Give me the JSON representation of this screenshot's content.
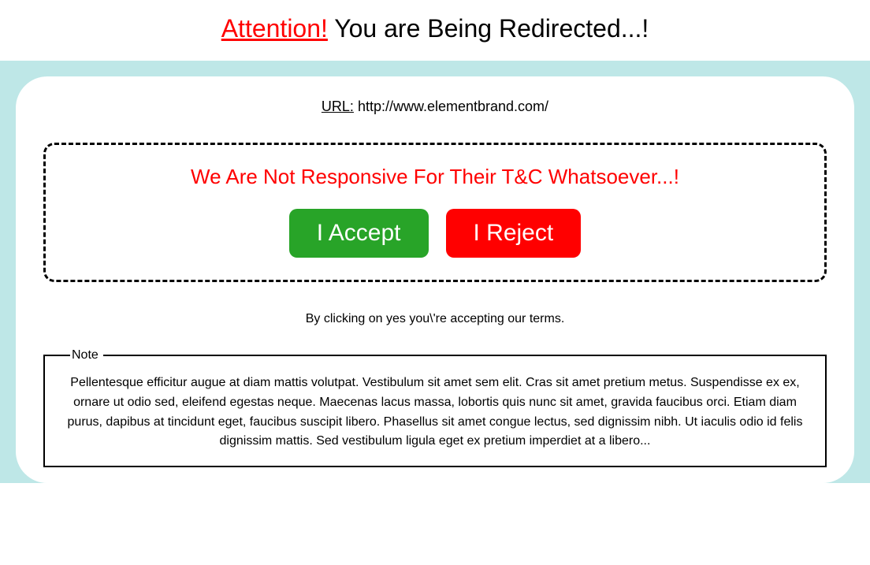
{
  "header": {
    "attention": "Attention!",
    "rest": " You are Being Redirected...!"
  },
  "url": {
    "label": "URL:",
    "value": " http://www.elementbrand.com/"
  },
  "disclaimer": {
    "text": "We Are Not Responsive For Their T&C Whatsoever...!"
  },
  "buttons": {
    "accept": "I Accept",
    "reject": "I Reject"
  },
  "terms_note": "By clicking on yes you\\'re accepting our terms.",
  "note": {
    "legend": "Note",
    "body": "Pellentesque efficitur augue at diam mattis volutpat. Vestibulum sit amet sem elit. Cras sit amet pretium metus. Suspendisse ex ex, ornare ut odio sed, eleifend egestas neque. Maecenas lacus massa, lobortis quis nunc sit amet, gravida faucibus orci. Etiam diam purus, dapibus at tincidunt eget, faucibus suscipit libero. Phasellus sit amet congue lectus, sed dignissim nibh. Ut iaculis odio id felis dignissim mattis. Sed vestibulum ligula eget ex pretium imperdiet at a libero..."
  },
  "colors": {
    "accent_red": "#ff0000",
    "accept_green": "#28a428",
    "outer_bg": "#bee7e7"
  }
}
